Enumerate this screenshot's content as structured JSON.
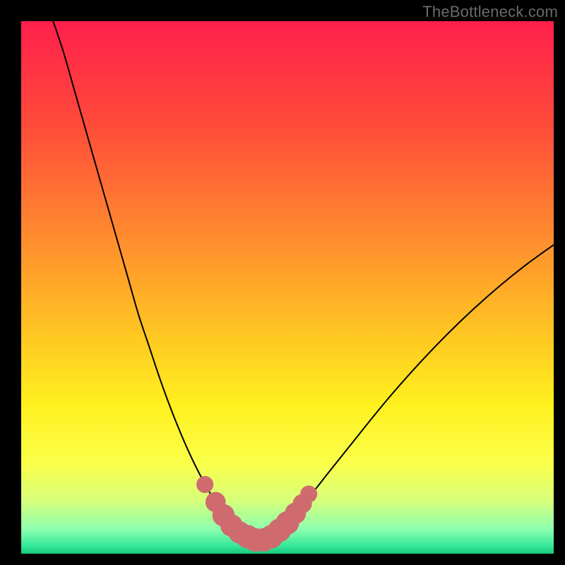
{
  "watermark": "TheBottleneck.com",
  "chart_data": {
    "type": "line",
    "title": "",
    "xlabel": "",
    "ylabel": "",
    "xlim": [
      0,
      100
    ],
    "ylim": [
      0,
      100
    ],
    "grid": false,
    "series": [
      {
        "name": "bottleneck-curve",
        "x": [
          6,
          8,
          10,
          12,
          14,
          16,
          18,
          20,
          22,
          24,
          26,
          28,
          30,
          32,
          34,
          35,
          36,
          37,
          38,
          39,
          40,
          41,
          42,
          43,
          44,
          45,
          46,
          48,
          50,
          52,
          55,
          58,
          62,
          66,
          70,
          75,
          80,
          85,
          90,
          95,
          100
        ],
        "y": [
          100,
          94,
          87,
          80,
          73,
          66,
          59,
          52,
          45,
          39,
          33,
          27.5,
          22.5,
          18,
          14,
          12.2,
          10.5,
          9,
          7.7,
          6.5,
          5.5,
          4.6,
          3.9,
          3.3,
          2.8,
          2.6,
          3.0,
          4.2,
          6.0,
          8.2,
          11.8,
          15.6,
          20.6,
          25.6,
          30.4,
          36.0,
          41.2,
          46.0,
          50.4,
          54.4,
          58.0
        ]
      }
    ],
    "markers": {
      "name": "highlight-points",
      "color": "#cf6b6f",
      "points": [
        {
          "x": 34.5,
          "y": 13.0,
          "r": 1.6
        },
        {
          "x": 36.5,
          "y": 9.7,
          "r": 1.9
        },
        {
          "x": 38.0,
          "y": 7.2,
          "r": 2.1
        },
        {
          "x": 39.5,
          "y": 5.3,
          "r": 2.1
        },
        {
          "x": 41.0,
          "y": 4.0,
          "r": 2.1
        },
        {
          "x": 42.5,
          "y": 3.2,
          "r": 2.2
        },
        {
          "x": 44.0,
          "y": 2.6,
          "r": 2.2
        },
        {
          "x": 45.5,
          "y": 2.6,
          "r": 2.2
        },
        {
          "x": 47.0,
          "y": 3.2,
          "r": 2.2
        },
        {
          "x": 48.5,
          "y": 4.4,
          "r": 2.2
        },
        {
          "x": 50.0,
          "y": 5.8,
          "r": 2.2
        },
        {
          "x": 51.5,
          "y": 7.6,
          "r": 2.0
        },
        {
          "x": 52.8,
          "y": 9.4,
          "r": 1.8
        },
        {
          "x": 54.0,
          "y": 11.2,
          "r": 1.6
        }
      ]
    },
    "background_gradient": {
      "stops": [
        {
          "offset": 0.0,
          "color": "#ff1f4b"
        },
        {
          "offset": 0.2,
          "color": "#ff4d3a"
        },
        {
          "offset": 0.4,
          "color": "#ff8a2e"
        },
        {
          "offset": 0.58,
          "color": "#ffc423"
        },
        {
          "offset": 0.72,
          "color": "#fff01e"
        },
        {
          "offset": 0.83,
          "color": "#faff4a"
        },
        {
          "offset": 0.9,
          "color": "#d7ff7a"
        },
        {
          "offset": 0.955,
          "color": "#8cffb0"
        },
        {
          "offset": 0.985,
          "color": "#35e89a"
        },
        {
          "offset": 1.0,
          "color": "#18c87a"
        }
      ]
    }
  }
}
